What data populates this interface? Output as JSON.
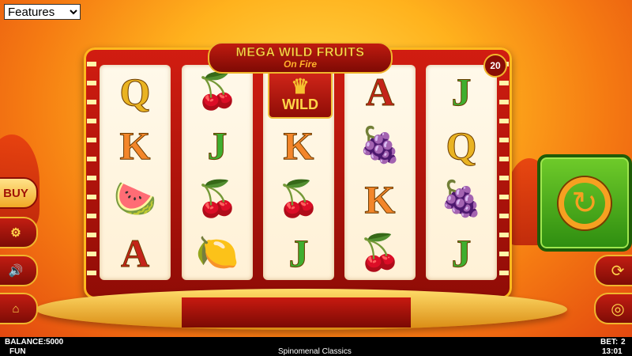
{
  "features_select": {
    "value": "Features",
    "options": [
      "Features"
    ]
  },
  "logo": {
    "title": "MEGA WILD FRUITS",
    "subtitle": "On Fire"
  },
  "lines_badge": "20",
  "reels": [
    [
      "Q",
      "cherry",
      "K-orange",
      "watermelon",
      "A"
    ],
    [
      "cherry",
      "J",
      "cherry",
      "lemon"
    ],
    [
      "WILD",
      "K",
      "cherry",
      "J"
    ],
    [
      "A",
      "grapes",
      "K",
      "cherry"
    ],
    [
      "J",
      "Q",
      "grapes",
      "J"
    ]
  ],
  "symbols": {
    "reel1": [
      "Q",
      "K",
      "🍉",
      "A"
    ],
    "reel2": [
      "🍒",
      "J",
      "🍒",
      "🍋"
    ],
    "reel3": [
      "WILD",
      "K",
      "🍒",
      "J"
    ],
    "reel4": [
      "A",
      "🍇",
      "K",
      "🍒"
    ],
    "reel5": [
      "J",
      "Q",
      "🍇",
      "J"
    ]
  },
  "buttons": {
    "buy": "BUY",
    "settings_icon": "gear-icon",
    "sound_icon": "speaker-icon",
    "home_icon": "home-icon",
    "autoplay_icon": "refresh-icon",
    "bet_icon": "coins-icon",
    "spin_icon": "spin-icon"
  },
  "status": {
    "balance_label": "BALANCE:",
    "balance_value": "5000",
    "mode": "FUN",
    "bet_label": "BET:",
    "bet_value": "2",
    "provider": "Spinomenal Classics",
    "time": "13:01"
  }
}
